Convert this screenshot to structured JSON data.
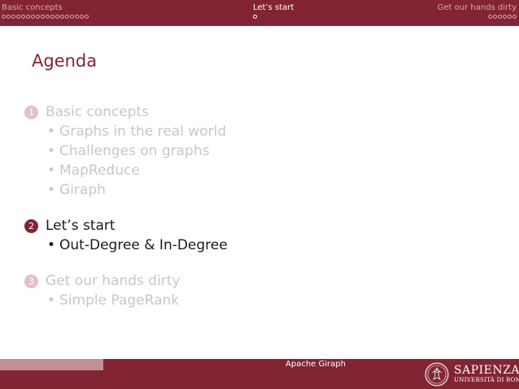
{
  "colors": {
    "brand": "#822433",
    "nav_dim": "#d6a9b0",
    "text_dim": "#c7c7c7",
    "circle_dim": "#e2c2c7"
  },
  "header": {
    "sections": [
      {
        "label": "Basic concepts",
        "dots": 18,
        "active": false
      },
      {
        "label": "Let’s start",
        "dots": 1,
        "active": true
      },
      {
        "label": "Get our hands dirty",
        "dots": 6,
        "active": false
      }
    ]
  },
  "slide": {
    "title": "Agenda",
    "sections": [
      {
        "number": "1",
        "title": "Basic concepts",
        "active": false,
        "items": [
          "Graphs in the real world",
          "Challenges on graphs",
          "MapReduce",
          "Giraph"
        ]
      },
      {
        "number": "2",
        "title": "Let’s start",
        "active": true,
        "items": [
          "Out-Degree & In-Degree"
        ]
      },
      {
        "number": "3",
        "title": "Get our hands dirty",
        "active": false,
        "items": [
          "Simple PageRank"
        ]
      }
    ]
  },
  "footer": {
    "center_text": "Apache Giraph",
    "logo": {
      "main": "SAPIENZA",
      "sub": "UNIVERSITÀ DI ROMA"
    }
  }
}
